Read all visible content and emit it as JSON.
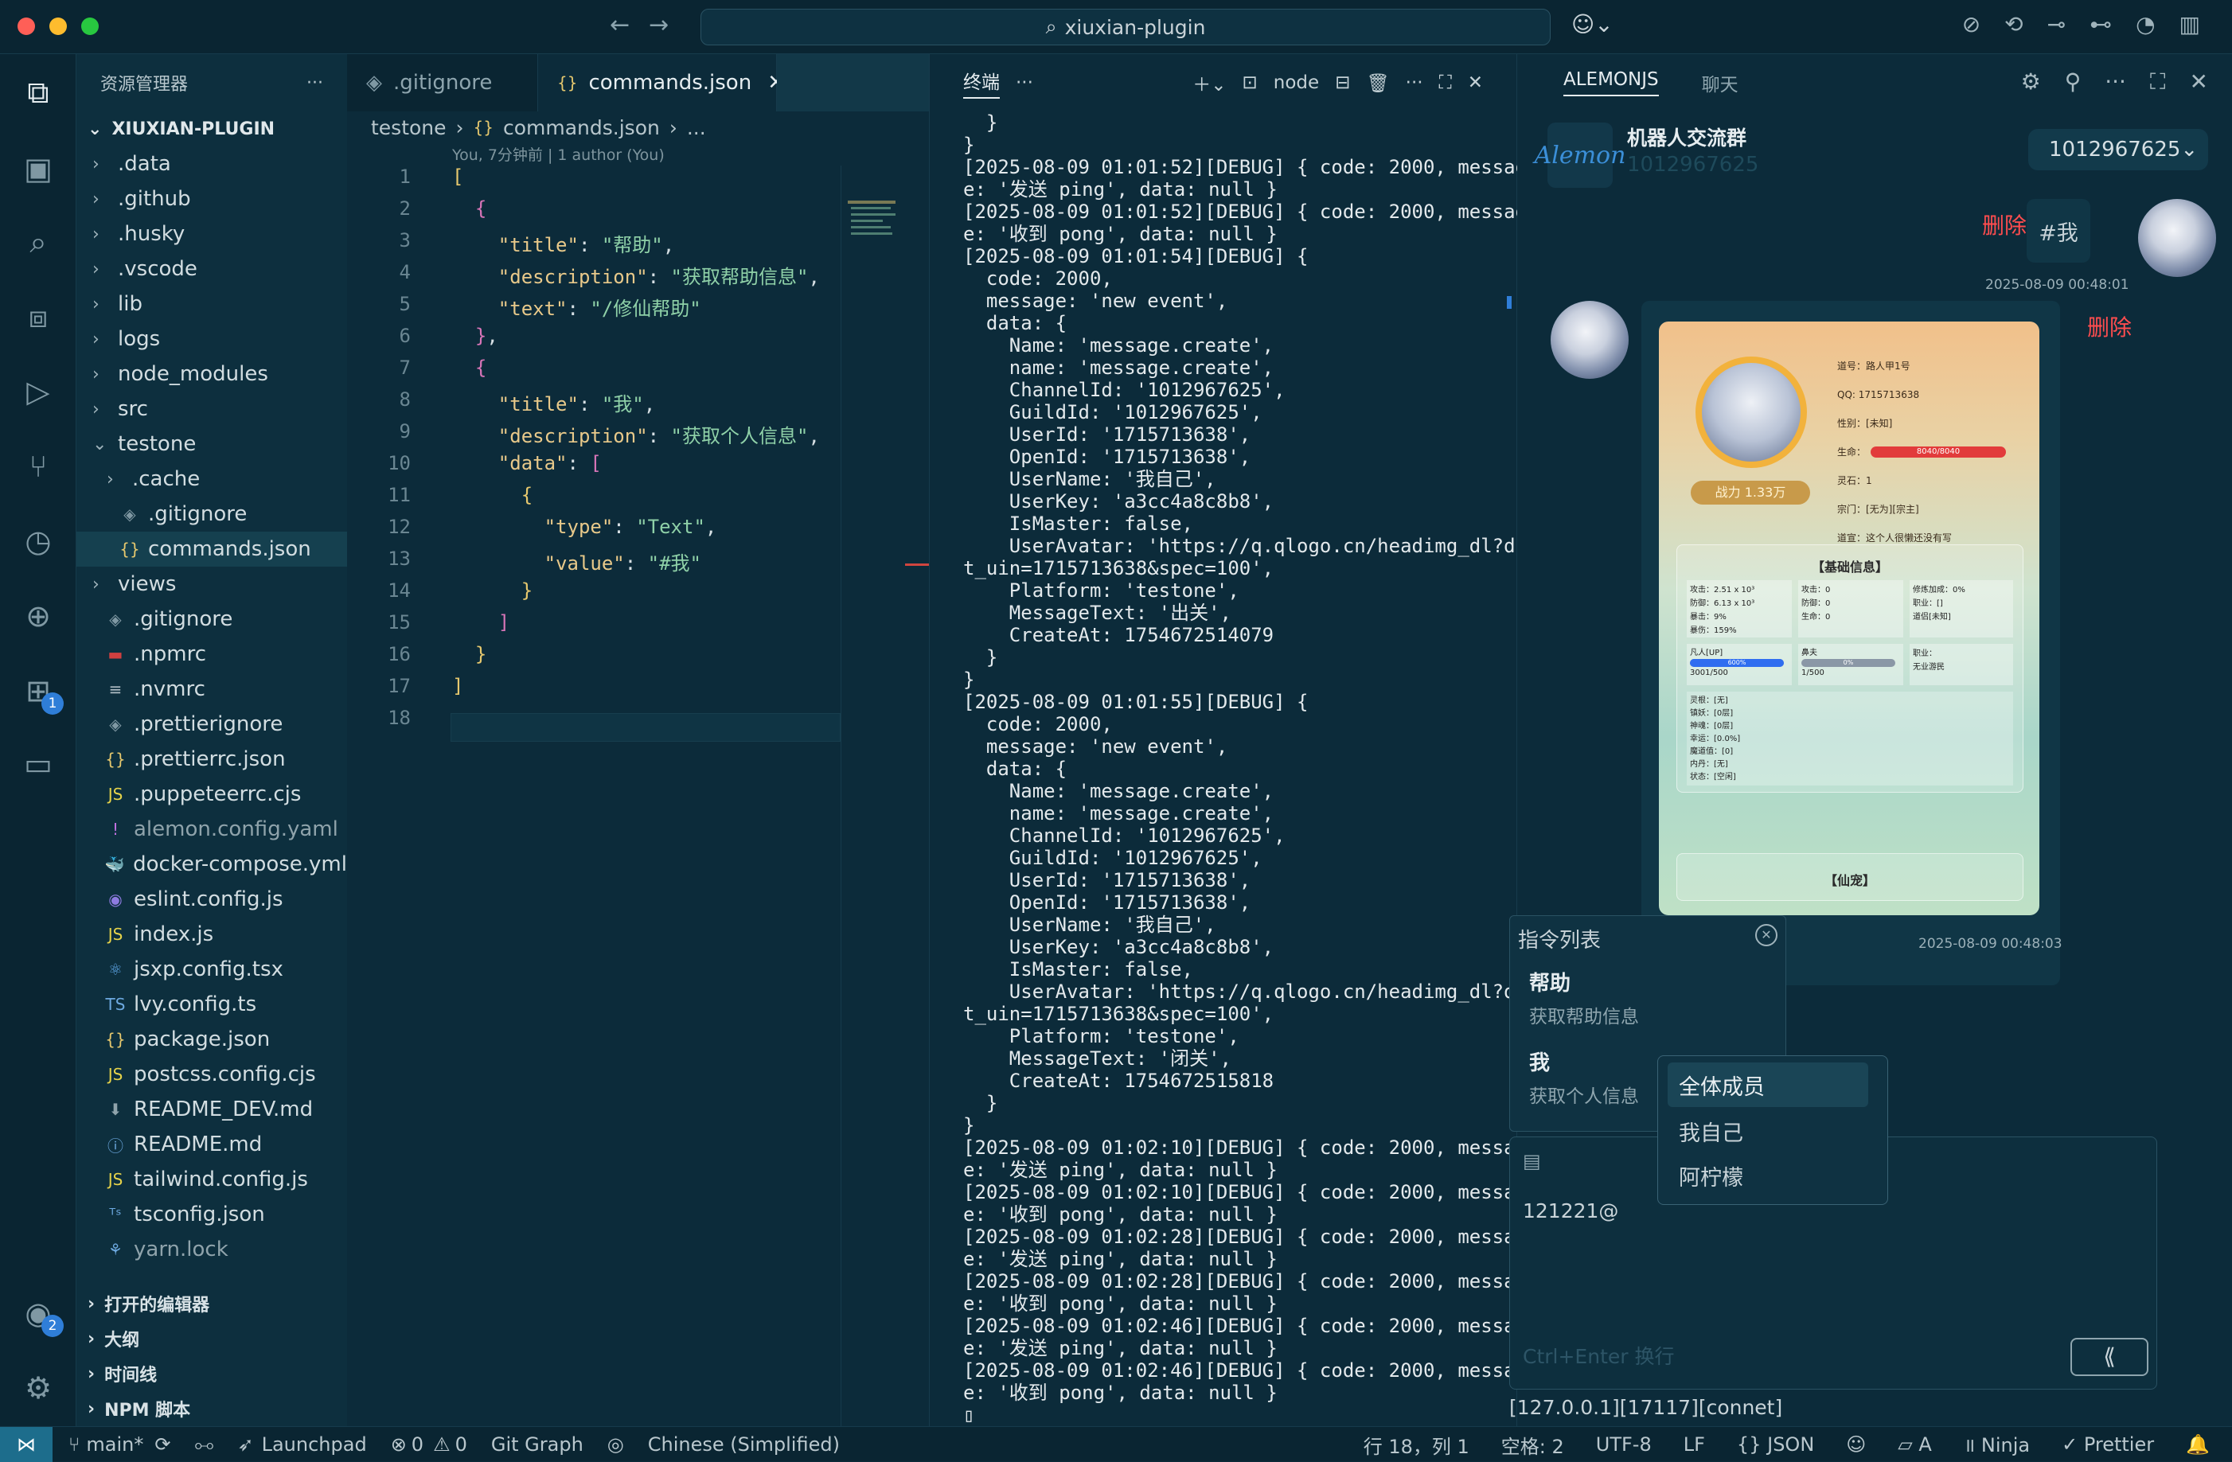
{
  "titlebar": {
    "search_text": "xiuxian-plugin"
  },
  "explorer": {
    "header": "资源管理器",
    "root": "XIUXIAN-PLUGIN",
    "items": [
      {
        "label": ".data",
        "kind": "folder",
        "indent": 0
      },
      {
        "label": ".github",
        "kind": "folder",
        "indent": 0
      },
      {
        "label": ".husky",
        "kind": "folder",
        "indent": 0
      },
      {
        "label": ".vscode",
        "kind": "folder",
        "indent": 0
      },
      {
        "label": "lib",
        "kind": "folder",
        "indent": 0
      },
      {
        "label": "logs",
        "kind": "folder",
        "indent": 0
      },
      {
        "label": "node_modules",
        "kind": "folder",
        "indent": 0
      },
      {
        "label": "src",
        "kind": "folder",
        "indent": 0
      },
      {
        "label": "testone",
        "kind": "folder-open",
        "indent": 0
      },
      {
        "label": ".cache",
        "kind": "folder",
        "indent": 1
      },
      {
        "label": ".gitignore",
        "kind": "git",
        "indent": 1
      },
      {
        "label": "commands.json",
        "kind": "json",
        "indent": 1,
        "selected": true
      },
      {
        "label": "views",
        "kind": "folder",
        "indent": 0
      },
      {
        "label": ".gitignore",
        "kind": "git",
        "indent": 0
      },
      {
        "label": ".npmrc",
        "kind": "npm",
        "indent": 0
      },
      {
        "label": ".nvmrc",
        "kind": "text",
        "indent": 0
      },
      {
        "label": ".prettierignore",
        "kind": "git",
        "indent": 0
      },
      {
        "label": ".prettierrc.json",
        "kind": "json",
        "indent": 0
      },
      {
        "label": ".puppeteerrc.cjs",
        "kind": "js",
        "indent": 0
      },
      {
        "label": "alemon.config.yaml",
        "kind": "yaml",
        "indent": 0,
        "dim": true
      },
      {
        "label": "docker-compose.yml",
        "kind": "docker",
        "indent": 0
      },
      {
        "label": "eslint.config.js",
        "kind": "eslint",
        "indent": 0
      },
      {
        "label": "index.js",
        "kind": "js",
        "indent": 0
      },
      {
        "label": "jsxp.config.tsx",
        "kind": "react",
        "indent": 0
      },
      {
        "label": "lvy.config.ts",
        "kind": "ts",
        "indent": 0
      },
      {
        "label": "package.json",
        "kind": "json",
        "indent": 0
      },
      {
        "label": "postcss.config.cjs",
        "kind": "js",
        "indent": 0
      },
      {
        "label": "README_DEV.md",
        "kind": "md",
        "indent": 0
      },
      {
        "label": "README.md",
        "kind": "info",
        "indent": 0
      },
      {
        "label": "tailwind.config.js",
        "kind": "js",
        "indent": 0
      },
      {
        "label": "tsconfig.json",
        "kind": "tsjson",
        "indent": 0
      },
      {
        "label": "yarn.lock",
        "kind": "yarn",
        "indent": 0,
        "dim": true
      }
    ],
    "sections": [
      "打开的编辑器",
      "大纲",
      "时间线",
      "NPM 脚本"
    ]
  },
  "editor": {
    "tabs": [
      {
        "label": ".gitignore",
        "active": false
      },
      {
        "label": "commands.json",
        "active": true
      }
    ],
    "breadcrumb": [
      "testone",
      "commands.json",
      "..."
    ],
    "blame": "You, 7分钟前 | 1 author (You)",
    "line_numbers": [
      "1",
      "2",
      "3",
      "4",
      "5",
      "6",
      "7",
      "8",
      "9",
      "10",
      "11",
      "12",
      "13",
      "14",
      "15",
      "16",
      "17",
      "18"
    ]
  },
  "terminal": {
    "tab": "终端",
    "shell": "node",
    "output": "  }\n}\n[2025-08-09 01:01:52][DEBUG] { code: 2000, messag\ne: '发送 ping', data: null }\n[2025-08-09 01:01:52][DEBUG] { code: 2000, messag\ne: '收到 pong', data: null }\n[2025-08-09 01:01:54][DEBUG] {\n  code: 2000,\n  message: 'new event',\n  data: {\n    Name: 'message.create',\n    name: 'message.create',\n    ChannelId: '1012967625',\n    GuildId: '1012967625',\n    UserId: '1715713638',\n    OpenId: '1715713638',\n    UserName: '我自己',\n    UserKey: 'a3cc4a8c8b8',\n    IsMaster: false,\n    UserAvatar: 'https://q.qlogo.cn/headimg_dl?ds\nt_uin=1715713638&spec=100',\n    Platform: 'testone',\n    MessageText: '出关',\n    CreateAt: 1754672514079\n  }\n}\n[2025-08-09 01:01:55][DEBUG] {\n  code: 2000,\n  message: 'new event',\n  data: {\n    Name: 'message.create',\n    name: 'message.create',\n    ChannelId: '1012967625',\n    GuildId: '1012967625',\n    UserId: '1715713638',\n    OpenId: '1715713638',\n    UserName: '我自己',\n    UserKey: 'a3cc4a8c8b8',\n    IsMaster: false,\n    UserAvatar: 'https://q.qlogo.cn/headimg_dl?ds\nt_uin=1715713638&spec=100',\n    Platform: 'testone',\n    MessageText: '闭关',\n    CreateAt: 1754672515818\n  }\n}\n[2025-08-09 01:02:10][DEBUG] { code: 2000, messag\ne: '发送 ping', data: null }\n[2025-08-09 01:02:10][DEBUG] { code: 2000, messag\ne: '收到 pong', data: null }\n[2025-08-09 01:02:28][DEBUG] { code: 2000, messag\ne: '发送 ping', data: null }\n[2025-08-09 01:02:28][DEBUG] { code: 2000, messag\ne: '收到 pong', data: null }\n[2025-08-09 01:02:46][DEBUG] { code: 2000, messag\ne: '发送 ping', data: null }\n[2025-08-09 01:02:46][DEBUG] { code: 2000, messag\ne: '收到 pong', data: null }\n▯"
  },
  "chat": {
    "tabs": [
      "ALEMONJS",
      "聊天"
    ],
    "group_logo": "Alemon",
    "group_name": "机器人交流群",
    "group_id": "1012967625",
    "channel_select": "1012967625",
    "my_message": "#我",
    "delete_label": "删除",
    "time1": "2025-08-09 00:48:01",
    "time2": "2025-08-09 00:48:03",
    "card": {
      "id": "道号：路人甲1号",
      "qq": "QQ: 1715713638",
      "gender": "性别：[未知]",
      "hp_label": "生命：",
      "hp": "8040/8040",
      "lingshi": "灵石：1",
      "sect": "宗门：[无为][宗主]",
      "motto": "道宣：这个人很懒还没有写",
      "power": "战力 1.33万",
      "section1": "【基础信息】",
      "stats_a": [
        "攻击：2.51 x 10³",
        "防御：6.13 x 10³",
        "暴击：9%",
        "暴伤：159%"
      ],
      "stats_b": [
        "攻击：0",
        "防御：0",
        "生命：0"
      ],
      "stats_c": [
        "修炼加成：0%",
        "职业：[]",
        "道侣[未知]"
      ],
      "realm": "凡人[UP]",
      "realm_val": "3001/500",
      "realm_pct": "600%",
      "realm_fill": 1.0,
      "qi": "鼻夫",
      "qi_val": "1/500",
      "qi_pct": "0%",
      "qi_fill": 0.0,
      "job": "职业：",
      "job_val": "无业游民",
      "props": [
        "灵根：[无]",
        "镇妖：[0层]",
        "神魂：[0层]",
        "幸运：[0.0%]",
        "魔道值：[0]",
        "内丹：[无]",
        "状态：[空闲]"
      ],
      "section2": "【仙宠】"
    },
    "cmd_panel": {
      "title": "指令列表",
      "items": [
        {
          "title": "帮助",
          "desc": "获取帮助信息"
        },
        {
          "title": "我",
          "desc": "获取个人信息"
        }
      ]
    },
    "mention_options": [
      "全体成员",
      "我自己",
      "阿柠檬"
    ],
    "input_value": "121221@",
    "input_placeholder": "Ctrl+Enter 换行",
    "conn_status": "[127.0.0.1][17117][connet]"
  },
  "statusbar": {
    "branch": "main*",
    "launchpad": "Launchpad",
    "errors": "0",
    "warnings": "0",
    "git_graph": "Git Graph",
    "language_pack": "Chinese (Simplified)",
    "cursor": "行 18，列 1",
    "spaces": "空格: 2",
    "encoding": "UTF-8",
    "eol": "LF",
    "lang": "JSON",
    "a_label": "A",
    "ninja": "Ninja",
    "prettier": "Prettier"
  },
  "colors": {
    "accent": "#2f7ed8",
    "bg": "#0c2b3a",
    "delete": "#ff4d4f"
  }
}
